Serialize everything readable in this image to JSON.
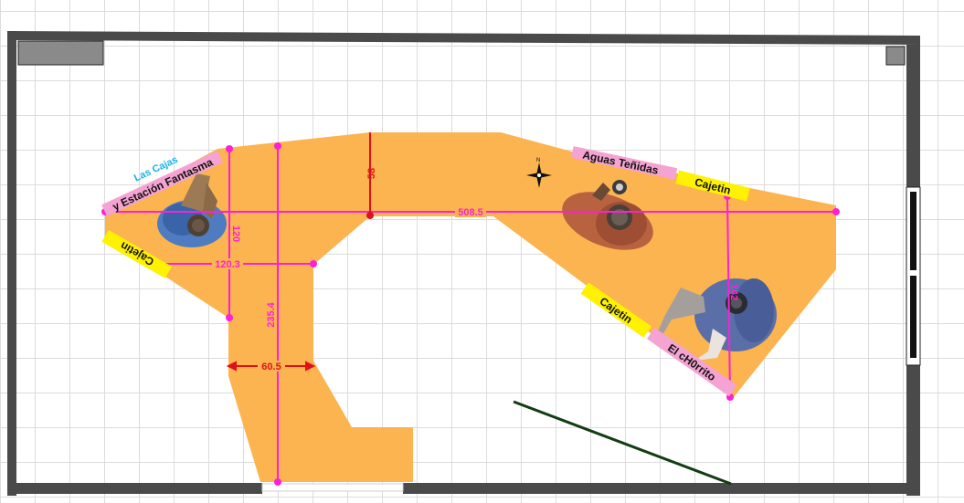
{
  "labels": {
    "las_cajas": "Las Cajas",
    "estacion_fantasma": "y Estación Fantasma",
    "aguas_tenidas": "Aguas Teñidas",
    "cajetin_top": "Cajetin",
    "cajetin_left": "Cajetin",
    "cajetin_right": "Cajetin",
    "el_chorrito": "El cH0rrito"
  },
  "dimensions": {
    "d508": "508.5",
    "d58": "58",
    "d120_3": "120.3",
    "d120": "120",
    "d235_4": "235.4",
    "d60_5": "60.5",
    "d_right": "142"
  },
  "colors": {
    "floor": "#fbb44f",
    "walls": "#4a4a4a",
    "dimension_pink": "#ff1fd6",
    "dimension_red": "#e0101a",
    "label_pink": "#f5a3d2",
    "label_yellow": "#fff200",
    "cyan": "#19b3e6"
  },
  "icons": {
    "compass": "compass-rose-icon",
    "figures": [
      "person-figure-icon",
      "person-figure-icon",
      "creature-figure-icon"
    ]
  }
}
